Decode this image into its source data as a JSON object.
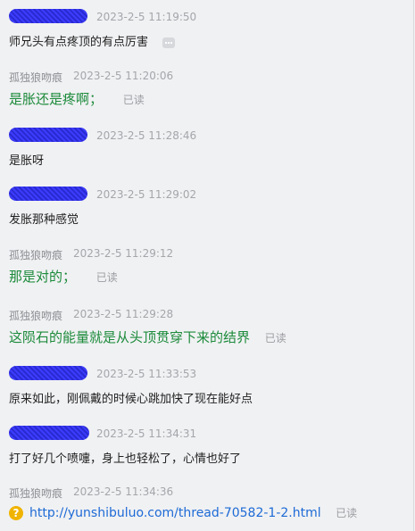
{
  "messages": [
    {
      "sender": "",
      "time": "2023-2-5 11:19:50",
      "text": "师兄头有点疼顶的有点厉害",
      "style": "normal",
      "read": "",
      "icon": "more-icon"
    },
    {
      "sender": "孤独狼吻痕",
      "time": "2023-2-5 11:20:06",
      "text": "是胀还是疼啊；",
      "style": "green",
      "read": "已读"
    },
    {
      "sender": "",
      "time": "2023-2-5 11:28:46",
      "text": "是胀呀",
      "style": "normal",
      "read": ""
    },
    {
      "sender": "",
      "time": "2023-2-5 11:29:02",
      "text": "发胀那种感觉",
      "style": "normal",
      "read": ""
    },
    {
      "sender": "孤独狼吻痕",
      "time": "2023-2-5 11:29:12",
      "text": "那是对的；",
      "style": "green",
      "read": "已读"
    },
    {
      "sender": "孤独狼吻痕",
      "time": "2023-2-5 11:29:28",
      "text": "这陨石的能量就是从头顶贯穿下来的结界",
      "style": "green",
      "read": "已读"
    },
    {
      "sender": "",
      "time": "2023-2-5 11:33:53",
      "text": "原来如此，刚佩戴的时候心跳加快了现在能好点",
      "style": "normal",
      "read": ""
    },
    {
      "sender": "",
      "time": "2023-2-5 11:34:31",
      "text": "打了好几个喷嚏，身上也轻松了，心情也好了",
      "style": "normal",
      "read": ""
    },
    {
      "sender": "孤独狼吻痕",
      "time": "2023-2-5 11:34:36",
      "text": "http://yunshibuluo.com/thread-70582-1-2.html",
      "style": "link",
      "read": "已读",
      "icon": "question-icon"
    }
  ]
}
